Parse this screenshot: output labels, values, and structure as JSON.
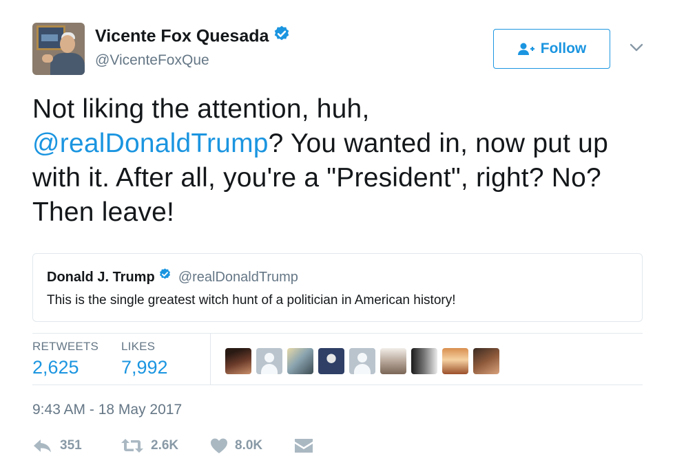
{
  "author": {
    "name": "Vicente Fox Quesada",
    "handle": "@VicenteFoxQue",
    "verified": true
  },
  "follow_button": {
    "label": "Follow"
  },
  "tweet": {
    "text_before_mention": "Not liking the attention, huh,",
    "mention": "@realDonaldTrump",
    "text_after_mention": "? You wanted in, now put up with it. After all, you're a \"President\", right? No? Then leave!"
  },
  "quoted_tweet": {
    "name": "Donald J. Trump",
    "handle": "@realDonaldTrump",
    "verified": true,
    "text": "This is the single greatest witch hunt of a politician in American history!"
  },
  "stats": {
    "retweets_label": "RETWEETS",
    "retweets_value": "2,625",
    "likes_label": "LIKES",
    "likes_value": "7,992"
  },
  "likers": [
    "photo",
    "default",
    "photo",
    "photo",
    "default",
    "photo",
    "photo",
    "photo",
    "photo"
  ],
  "timestamp": "9:43 AM - 18 May 2017",
  "actions": {
    "reply_count": "351",
    "retweet_count": "2.6K",
    "like_count": "8.0K"
  },
  "colors": {
    "accent": "#1b95e0",
    "muted": "#657786",
    "icon": "#8899a6",
    "text": "#14171a",
    "border": "#e1e8ed"
  },
  "icons": [
    "verified-badge-icon",
    "follow-person-icon",
    "chevron-down-icon",
    "reply-icon",
    "retweet-icon",
    "heart-icon",
    "direct-message-icon"
  ]
}
